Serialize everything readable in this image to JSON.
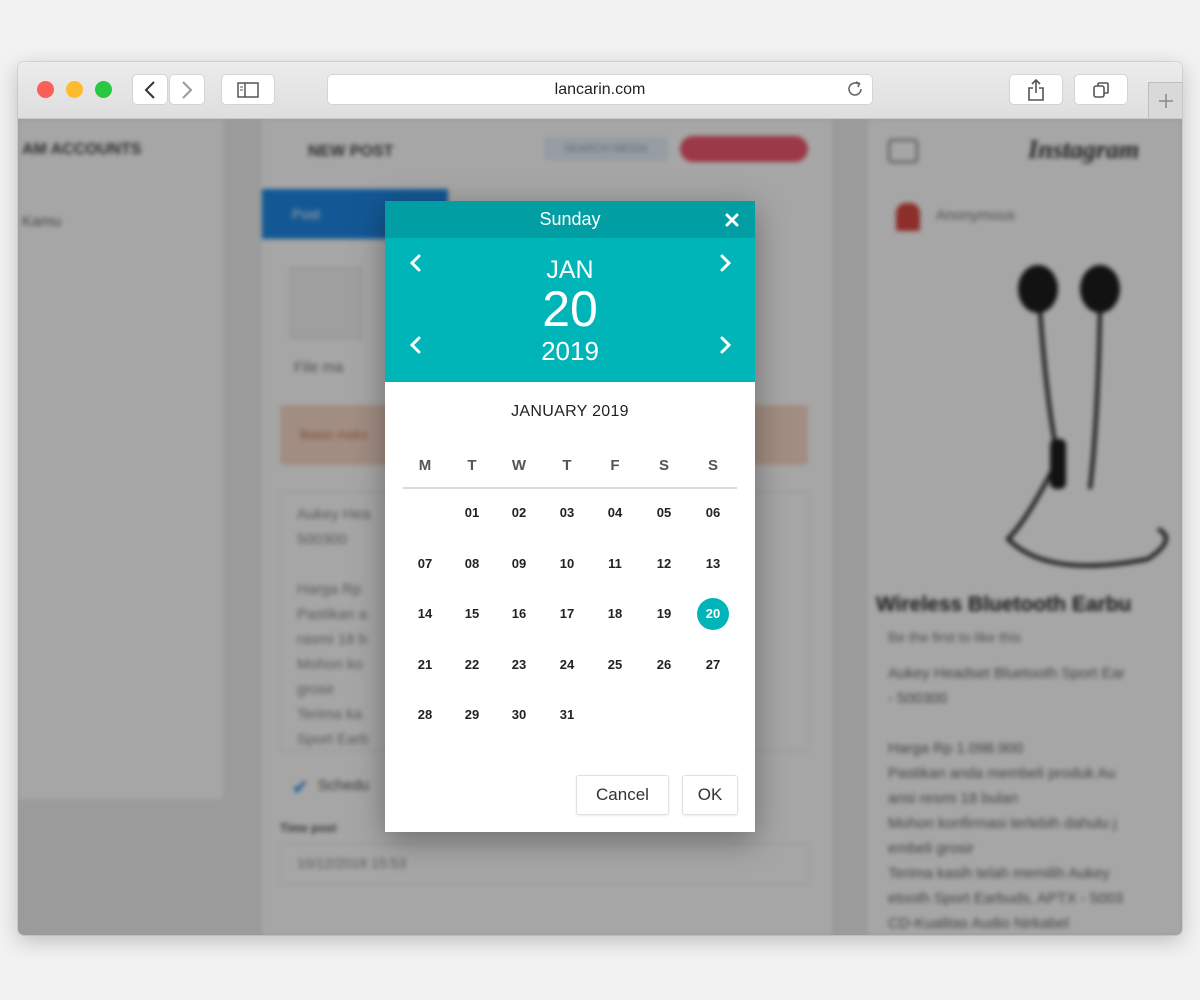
{
  "browser": {
    "url": "lancarin.com"
  },
  "background": {
    "sidebar_header": "AM ACCOUNTS",
    "sidebar_account": "Kamu",
    "new_post_title": "NEW POST",
    "search_media": "SEARCH MEDIA",
    "tab_post": "Post",
    "file_manager": "File ma",
    "alert_text": "Batas maks",
    "caption_lines": [
      "Aukey Hea",
      "500300",
      "",
      "Harga Rp",
      "Pastikan a",
      "rasmi 18 b",
      "Mohon ko",
      "grosir",
      "Terima ka",
      "Sport Earb"
    ],
    "schedule_label": "Schedu",
    "time_post_label": "Time post",
    "time_post_value": "10/12/2018 15:53",
    "preview_brand": "Instagram",
    "preview_user": "Anonymous",
    "preview_title": "Wireless Bluetooth Earbu",
    "preview_likes": "Be the first to like this",
    "preview_lines": [
      "Aukey Headset Bluetooth Sport Ear",
      "- 500300",
      "",
      "Harga Rp 1.098.900",
      "Pastikan anda membeli produk Au",
      "ansi resmi 18 bulan",
      "Mohon konfirmasi terlebih dahulu j",
      "embeli grosir",
      "Terima kasih telah memilih Aukey",
      "etooth Sport Earbuds, APTX - 5003",
      "CD-Kualitas Audio Nirkabel"
    ]
  },
  "datepicker": {
    "weekday": "Sunday",
    "month": "JAN",
    "day": "20",
    "year": "2019",
    "calendar_title": "JANUARY 2019",
    "weekday_headers": [
      "M",
      "T",
      "W",
      "T",
      "F",
      "S",
      "S"
    ],
    "first_weekday_index": 1,
    "days": [
      "01",
      "02",
      "03",
      "04",
      "05",
      "06",
      "07",
      "08",
      "09",
      "10",
      "11",
      "12",
      "13",
      "14",
      "15",
      "16",
      "17",
      "18",
      "19",
      "20",
      "21",
      "22",
      "23",
      "24",
      "25",
      "26",
      "27",
      "28",
      "29",
      "30",
      "31"
    ],
    "selected_day": "20",
    "cancel_label": "Cancel",
    "ok_label": "OK",
    "colors": {
      "header": "#019fa3",
      "accent": "#00b5b8"
    }
  }
}
